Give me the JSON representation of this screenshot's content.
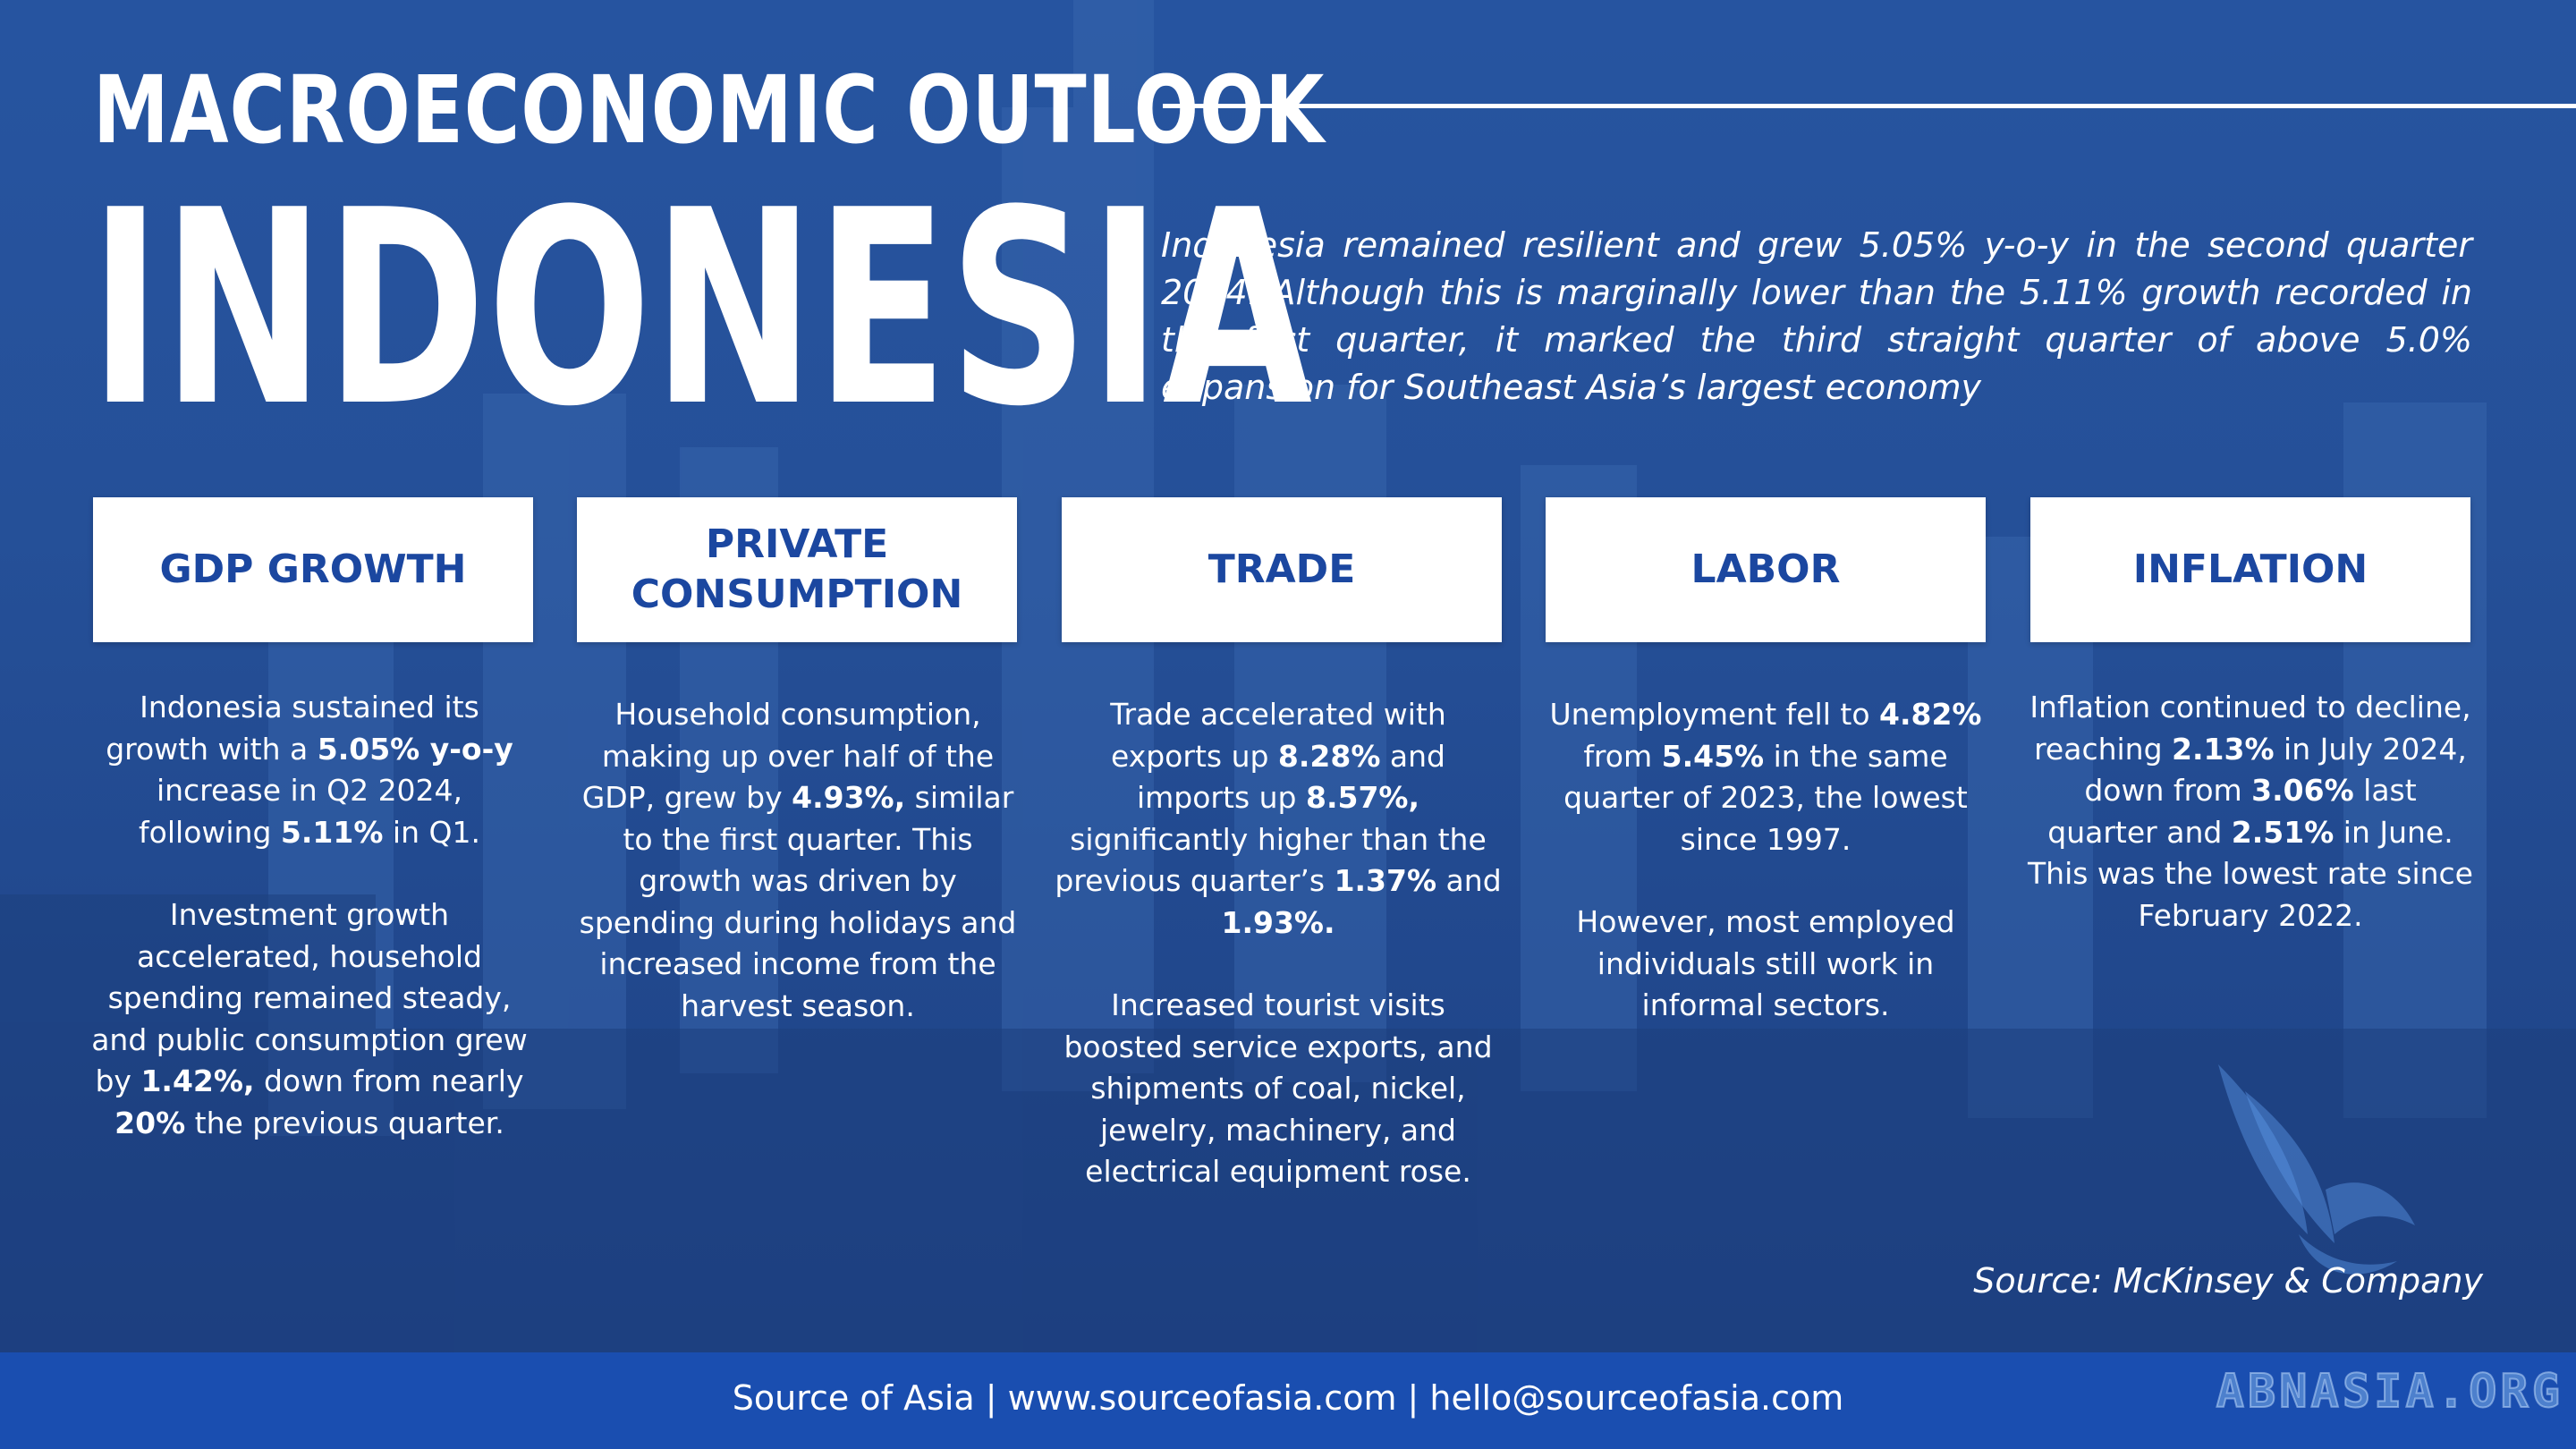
{
  "header": {
    "title_small": "MACROECONOMIC OUTLOOK",
    "title_big": "INDONESIA",
    "intro": "Indonesia remained resilient and grew 5.05% y-o-y in the second quarter 2024. Although this is marginally lower than the 5.11% growth recorded in the first quarter, it marked the third straight quarter of above 5.0% expansion for Southeast Asia’s largest economy"
  },
  "cards": [
    {
      "label": "GDP GROWTH"
    },
    {
      "label": "PRIVATE\nCONSUMPTION"
    },
    {
      "label": "TRADE"
    },
    {
      "label": "LABOR"
    },
    {
      "label": "INFLATION"
    }
  ],
  "columns": [
    {
      "paragraphs": [
        [
          "Indonesia sustained its growth with a ",
          {
            "b": "5.05% y-o-y"
          },
          " increase in Q2 2024, following ",
          {
            "b": "5.11%"
          },
          " in Q1."
        ],
        [
          "Investment growth accelerated, household spending remained steady, and public consumption grew by ",
          {
            "b": "1.42%,"
          },
          " down from nearly ",
          {
            "b": "20%"
          },
          " the previous quarter."
        ]
      ]
    },
    {
      "paragraphs": [
        [
          "Household consumption, making up over half of the GDP, grew by ",
          {
            "b": "4.93%,"
          },
          " similar to the first quarter. This growth was driven by spending during holidays and increased income from the harvest season."
        ]
      ]
    },
    {
      "paragraphs": [
        [
          "Trade accelerated with exports up ",
          {
            "b": "8.28%"
          },
          " and imports up ",
          {
            "b": "8.57%,"
          },
          " significantly higher than the previous quarter’s ",
          {
            "b": "1.37%"
          },
          " and ",
          {
            "b": "1.93%."
          }
        ],
        [
          "Increased tourist visits boosted service exports, and shipments of coal, nickel, jewelry, machinery, and electrical equipment rose."
        ]
      ]
    },
    {
      "paragraphs": [
        [
          "Unemployment fell to ",
          {
            "b": "4.82%"
          },
          " from ",
          {
            "b": "5.45%"
          },
          " in the same quarter of 2023, the lowest since 1997."
        ],
        [
          "However, most employed individuals still work in informal sectors."
        ]
      ]
    },
    {
      "paragraphs": [
        [
          "Inflation continued to decline, reaching ",
          {
            "b": "2.13%"
          },
          " in July 2024, down from ",
          {
            "b": "3.06%"
          },
          " last quarter and ",
          {
            "b": "2.51%"
          },
          " in June. This was the lowest rate since February 2022."
        ]
      ]
    }
  ],
  "source": "Source: McKinsey & Company",
  "footer": "Source of Asia | www.sourceofasia.com | hello@sourceofasia.com",
  "watermark": "ABNASIA.ORG",
  "colors": {
    "background": "#2b5aa3",
    "card_text": "#1b47a0",
    "footer": "#1a4eb0"
  }
}
